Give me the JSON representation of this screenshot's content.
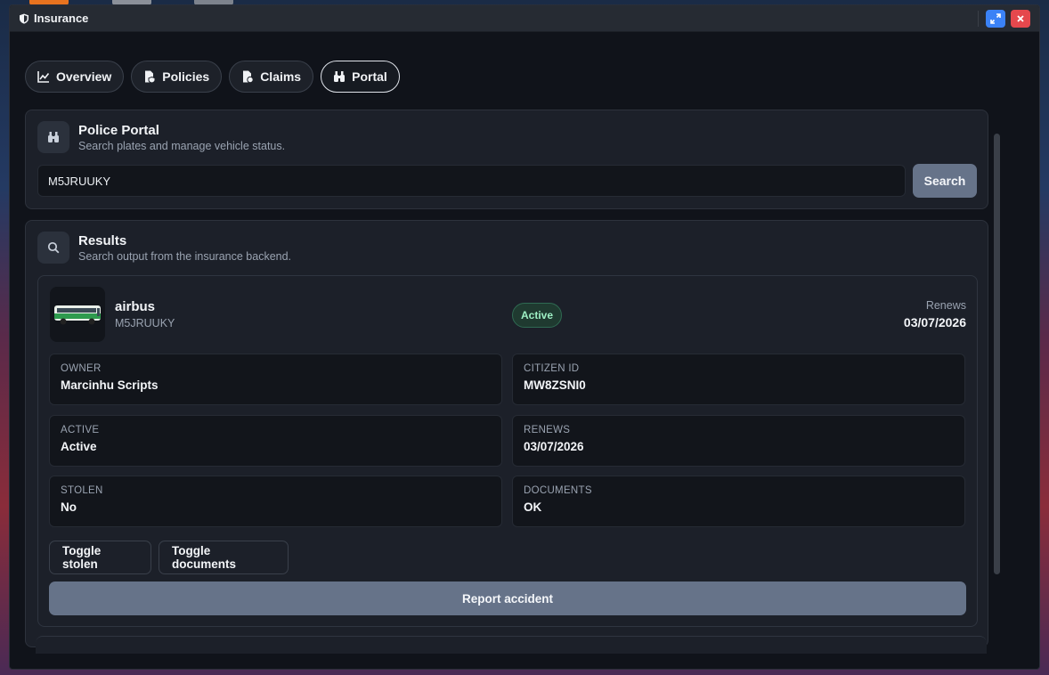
{
  "window": {
    "title": "Insurance"
  },
  "tabs": [
    {
      "label": "Overview",
      "icon": "chart-line-icon"
    },
    {
      "label": "Policies",
      "icon": "file-shield-icon"
    },
    {
      "label": "Claims",
      "icon": "file-coin-icon"
    },
    {
      "label": "Portal",
      "icon": "binoculars-icon",
      "active": true
    }
  ],
  "portal": {
    "title": "Police Portal",
    "subtitle": "Search plates and manage vehicle status.",
    "search_value": "M5JRUUKY",
    "search_button": "Search"
  },
  "results": {
    "title": "Results",
    "subtitle": "Search output from the insurance backend.",
    "vehicle": {
      "name": "airbus",
      "plate": "M5JRUUKY",
      "status": "Active",
      "renews_label": "Renews",
      "renews_value": "03/07/2026",
      "fields": [
        {
          "label": "OWNER",
          "value": "Marcinhu Scripts"
        },
        {
          "label": "CITIZEN ID",
          "value": "MW8ZSNI0"
        },
        {
          "label": "ACTIVE",
          "value": "Active"
        },
        {
          "label": "RENEWS",
          "value": "03/07/2026"
        },
        {
          "label": "STOLEN",
          "value": "No"
        },
        {
          "label": "DOCUMENTS",
          "value": "OK"
        }
      ],
      "toggle_stolen": "Toggle stolen",
      "toggle_documents": "Toggle documents",
      "report_accident": "Report accident"
    }
  },
  "colors": {
    "accent_button": "#667389",
    "status_green": "#9ef0c4",
    "close_red": "#e5484d",
    "maximize_blue": "#3b82f6"
  }
}
